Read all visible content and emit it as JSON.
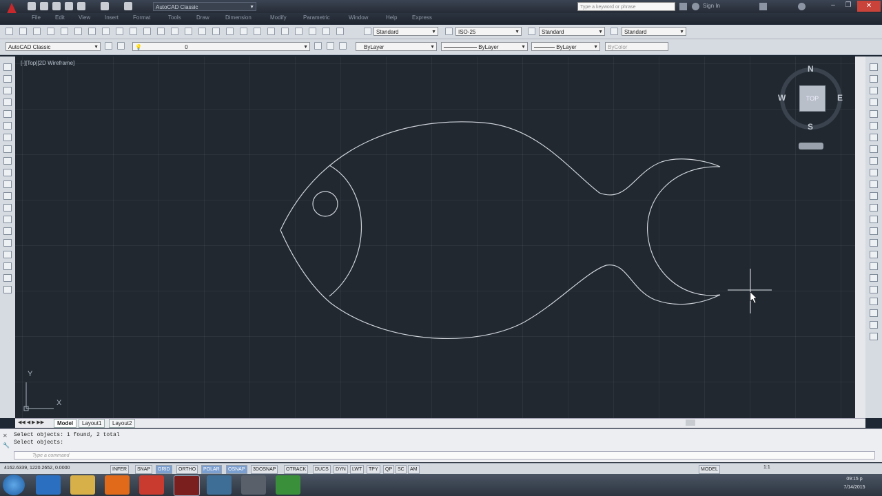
{
  "title_bar": {
    "workspace": "AutoCAD Classic",
    "search_placeholder": "Type a keyword or phrase",
    "sign_in": "Sign In"
  },
  "menu": [
    "File",
    "Edit",
    "View",
    "Insert",
    "Format",
    "Tools",
    "Draw",
    "Dimension",
    "Modify",
    "Parametric",
    "Window",
    "Help",
    "Express"
  ],
  "styles": {
    "text_style": "Standard",
    "dim_style": "ISO-25",
    "table_style": "Standard",
    "multileader_style": "Standard"
  },
  "layers": {
    "workspace": "AutoCAD Classic",
    "layer": "0",
    "color": "ByLayer",
    "linetype": "ByLayer",
    "lineweight": "ByLayer",
    "plotstyle": "ByColor"
  },
  "viewport": {
    "label": "[-][Top][2D Wireframe]",
    "compass": {
      "n": "N",
      "s": "S",
      "e": "E",
      "w": "W",
      "face": "TOP"
    },
    "ucs_x": "X",
    "ucs_y": "Y"
  },
  "layout_tabs": [
    "Model",
    "Layout1",
    "Layout2"
  ],
  "command": {
    "history": [
      "Select objects: 1 found, 2 total",
      "Select objects:"
    ],
    "placeholder": "Type a command"
  },
  "status": {
    "coordinates": "4162.6339, 1220.2652, 0.0000",
    "toggles": [
      {
        "label": "INFER",
        "on": false
      },
      {
        "label": "SNAP",
        "on": false
      },
      {
        "label": "GRID",
        "on": true
      },
      {
        "label": "ORTHO",
        "on": false
      },
      {
        "label": "POLAR",
        "on": true
      },
      {
        "label": "OSNAP",
        "on": true
      },
      {
        "label": "3DOSNAP",
        "on": false
      },
      {
        "label": "OTRACK",
        "on": false
      },
      {
        "label": "DUCS",
        "on": false
      },
      {
        "label": "DYN",
        "on": false
      },
      {
        "label": "LWT",
        "on": false
      },
      {
        "label": "TPY",
        "on": false
      },
      {
        "label": "QP",
        "on": false
      },
      {
        "label": "SC",
        "on": false
      },
      {
        "label": "AM",
        "on": false
      }
    ],
    "model_label": "MODEL",
    "scale": "1:1"
  },
  "taskbar": {
    "time": "09:15 p",
    "date": "7/14/2015"
  },
  "colors": {
    "canvas": "#212830",
    "geometry": "#d0d4da",
    "accent_on": "#7b9fd0"
  }
}
